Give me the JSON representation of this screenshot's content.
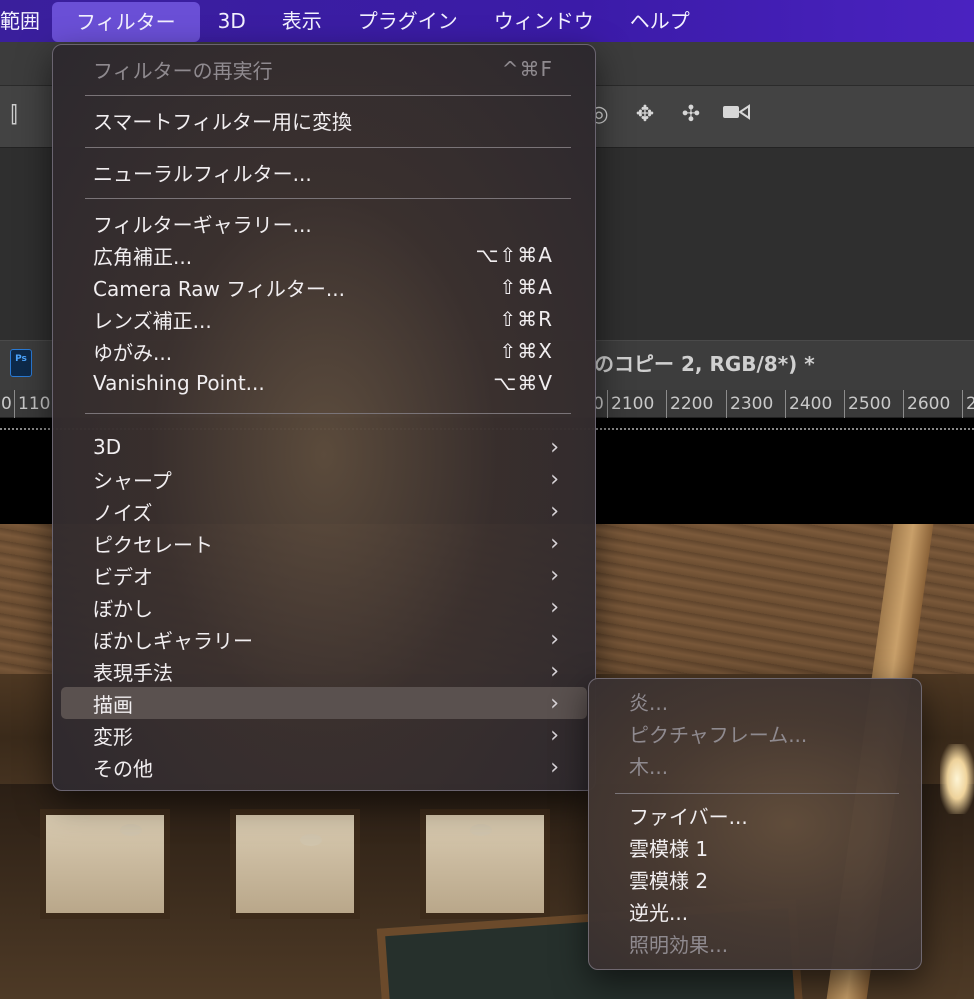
{
  "menubar": {
    "items": [
      {
        "label": "範囲"
      },
      {
        "label": "フィルター",
        "active": true
      },
      {
        "label": "3D"
      },
      {
        "label": "表示"
      },
      {
        "label": "プラグイン"
      },
      {
        "label": "ウィンドウ"
      },
      {
        "label": "ヘルプ"
      }
    ]
  },
  "document": {
    "title": "のコピー 2, RGB/8*) *",
    "file_icon_text": "Ps"
  },
  "ruler": {
    "left_ticks": [
      "0",
      "110"
    ],
    "right_ticks": [
      "0",
      "2100",
      "2200",
      "2300",
      "2400",
      "2500",
      "2600",
      "2"
    ]
  },
  "filter_menu": {
    "reapply": {
      "label": "フィルターの再実行",
      "shortcut": "^⌘F",
      "enabled": false
    },
    "smart_filter": {
      "label": "スマートフィルター用に変換"
    },
    "neural": {
      "label": "ニューラルフィルター..."
    },
    "gallery": {
      "label": "フィルターギャラリー..."
    },
    "adaptive_wide": {
      "label": "広角補正...",
      "shortcut": "⌥⇧⌘A"
    },
    "camera_raw": {
      "label": "Camera Raw フィルター...",
      "shortcut": "⇧⌘A"
    },
    "lens": {
      "label": "レンズ補正...",
      "shortcut": "⇧⌘R"
    },
    "liquify": {
      "label": "ゆがみ...",
      "shortcut": "⇧⌘X"
    },
    "vanishing": {
      "label": "Vanishing Point...",
      "shortcut": "⌥⌘V"
    },
    "submenus": [
      {
        "label": "3D"
      },
      {
        "label": "シャープ"
      },
      {
        "label": "ノイズ"
      },
      {
        "label": "ピクセレート"
      },
      {
        "label": "ビデオ"
      },
      {
        "label": "ぼかし"
      },
      {
        "label": "ぼかしギャラリー"
      },
      {
        "label": "表現手法"
      },
      {
        "label": "描画",
        "highlighted": true
      },
      {
        "label": "変形"
      },
      {
        "label": "その他"
      }
    ],
    "arrow_glyph": "›"
  },
  "render_submenu": {
    "items": [
      {
        "label": "炎...",
        "enabled": false
      },
      {
        "label": "ピクチャフレーム...",
        "enabled": false
      },
      {
        "label": "木...",
        "enabled": false
      },
      {
        "label": "ファイバー...",
        "enabled": true
      },
      {
        "label": "雲模様 1",
        "enabled": true
      },
      {
        "label": "雲模様 2",
        "enabled": true
      },
      {
        "label": "逆光...",
        "enabled": true
      },
      {
        "label": "照明効果...",
        "enabled": false
      }
    ]
  },
  "colors": {
    "menubar": "#3b1ba8",
    "menubar_active": "#6a4fd6",
    "menu_highlight": "#5a514f"
  }
}
